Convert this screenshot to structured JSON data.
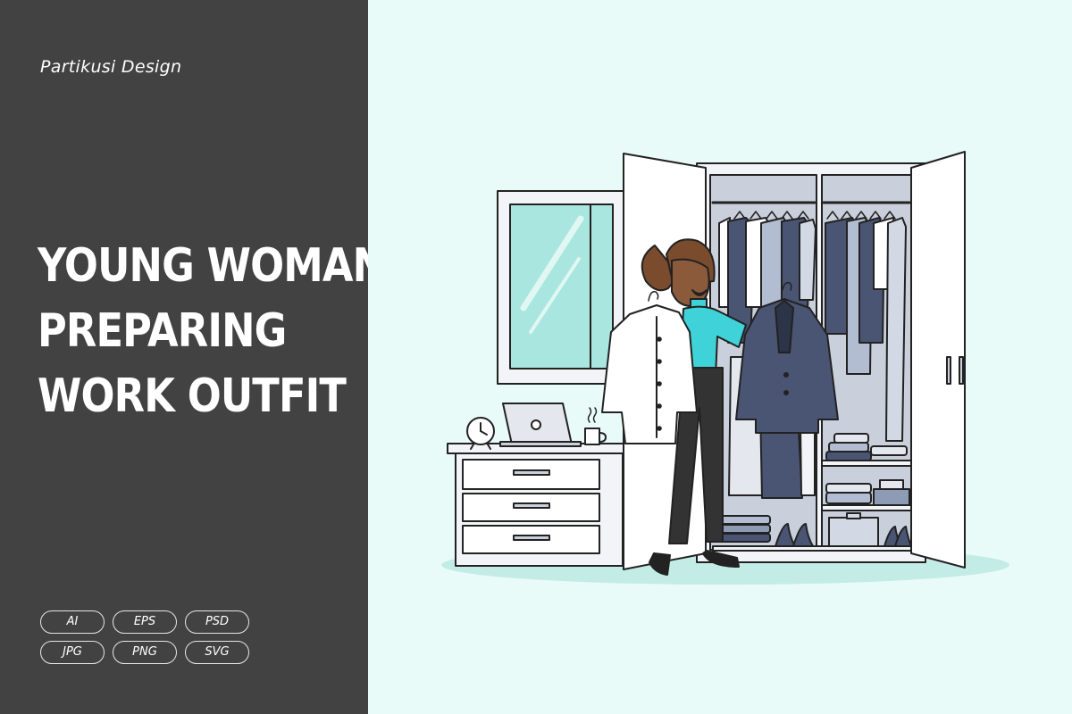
{
  "brand": "Partikusi Design",
  "title_lines": [
    "YOUNG WOMAN",
    "PREPARING",
    "WORK OUTFIT"
  ],
  "formats": [
    "AI",
    "EPS",
    "PSD",
    "JPG",
    "PNG",
    "SVG"
  ],
  "colors": {
    "panel": "#424242",
    "background": "#e9fbf8",
    "accent_teal": "#3fd3d9",
    "navy": "#4a5573",
    "outline": "#222222"
  }
}
